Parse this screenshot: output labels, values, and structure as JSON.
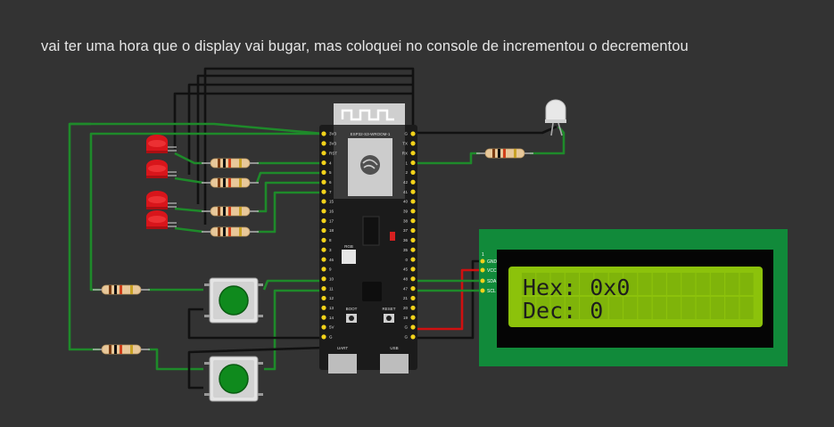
{
  "note": "vai ter uma hora que o display vai bugar, mas coloquei no console de incrementou o decrementou",
  "lcd": {
    "line1": "Hex: 0x0",
    "line2": "Dec: 0",
    "pin_marker": "1",
    "pins": [
      "GND",
      "VCC",
      "SDA",
      "SCL"
    ],
    "backlight_color": "#8cc20b",
    "board_color": "#118a3a"
  },
  "esp32": {
    "module_label": "ESP32-S3-WROOM-1",
    "rgb_label": "RGB",
    "boot_label": "BOOT",
    "reset_label": "RESET",
    "uart_label": "UART",
    "usb_label": "USB",
    "left_pins": [
      "3V3",
      "3V3",
      "RST",
      "4",
      "5",
      "6",
      "7",
      "15",
      "16",
      "17",
      "18",
      "8",
      "3",
      "46",
      "9",
      "10",
      "11",
      "12",
      "13",
      "14",
      "5V",
      "G"
    ],
    "right_pins": [
      "G",
      "TX",
      "RX",
      "1",
      "2",
      "42",
      "41",
      "40",
      "39",
      "38",
      "37",
      "36",
      "35",
      "0",
      "45",
      "48",
      "47",
      "21",
      "20",
      "19",
      "G",
      "G"
    ]
  },
  "colors": {
    "wire_green": "#1e8a2a",
    "wire_black": "#111111",
    "wire_red": "#d01010",
    "led_red": "#d8151b",
    "button_cap": "#0f8a1d"
  }
}
